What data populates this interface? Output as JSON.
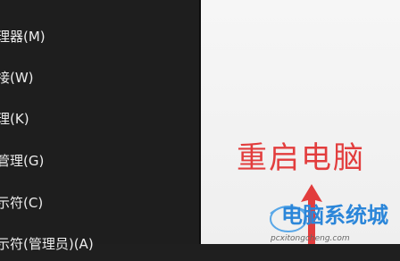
{
  "context_menu": {
    "items": [
      {
        "label": "理器(M)"
      },
      {
        "label": "接(W)"
      },
      {
        "label": "理(K)"
      },
      {
        "label": "管理(G)"
      },
      {
        "label": "示符(C)"
      },
      {
        "label": "示符(管理员)(A)"
      }
    ]
  },
  "desktop": {
    "annotation_text": "重启电脑",
    "annotation_color": "#e23d3d",
    "watermark": {
      "main_text": "电脑系统城",
      "url_text": "pcxitongcheng.com"
    }
  }
}
